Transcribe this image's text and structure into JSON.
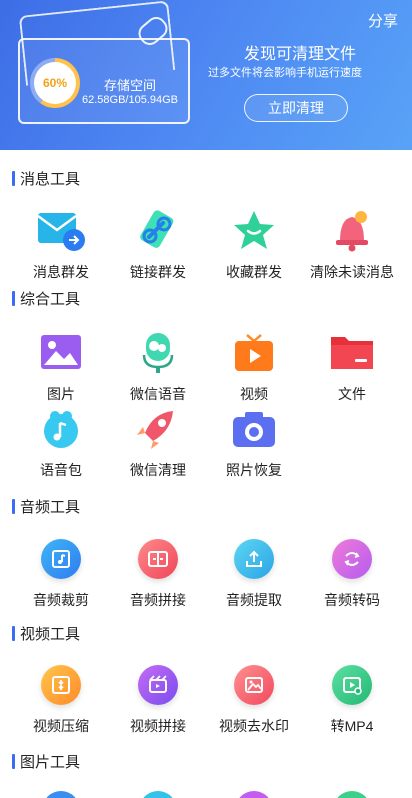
{
  "header": {
    "share": "分享",
    "percent": "60%",
    "storage_title": "存储空间",
    "storage_value": "62.58GB/105.94GB",
    "clean_title": "发现可清理文件",
    "clean_subtitle": "过多文件将会影响手机运行速度",
    "clean_button": "立即清理",
    "progress": 0.6
  },
  "sections": {
    "message": {
      "title": "消息工具",
      "items": [
        "消息群发",
        "链接群发",
        "收藏群发",
        "清除未读消息"
      ]
    },
    "general": {
      "title": "综合工具",
      "items": [
        "图片",
        "微信语音",
        "视频",
        "文件",
        "语音包",
        "微信清理",
        "照片恢复"
      ]
    },
    "audio": {
      "title": "音频工具",
      "items": [
        "音频裁剪",
        "音频拼接",
        "音频提取",
        "音频转码"
      ]
    },
    "video": {
      "title": "视频工具",
      "items": [
        "视频压缩",
        "视频拼接",
        "视频去水印",
        "转MP4"
      ]
    },
    "image": {
      "title": "图片工具"
    }
  },
  "colors": {
    "accent": "#3b6cf6",
    "header_start": "#3d6de6",
    "header_end": "#58a3f7"
  }
}
